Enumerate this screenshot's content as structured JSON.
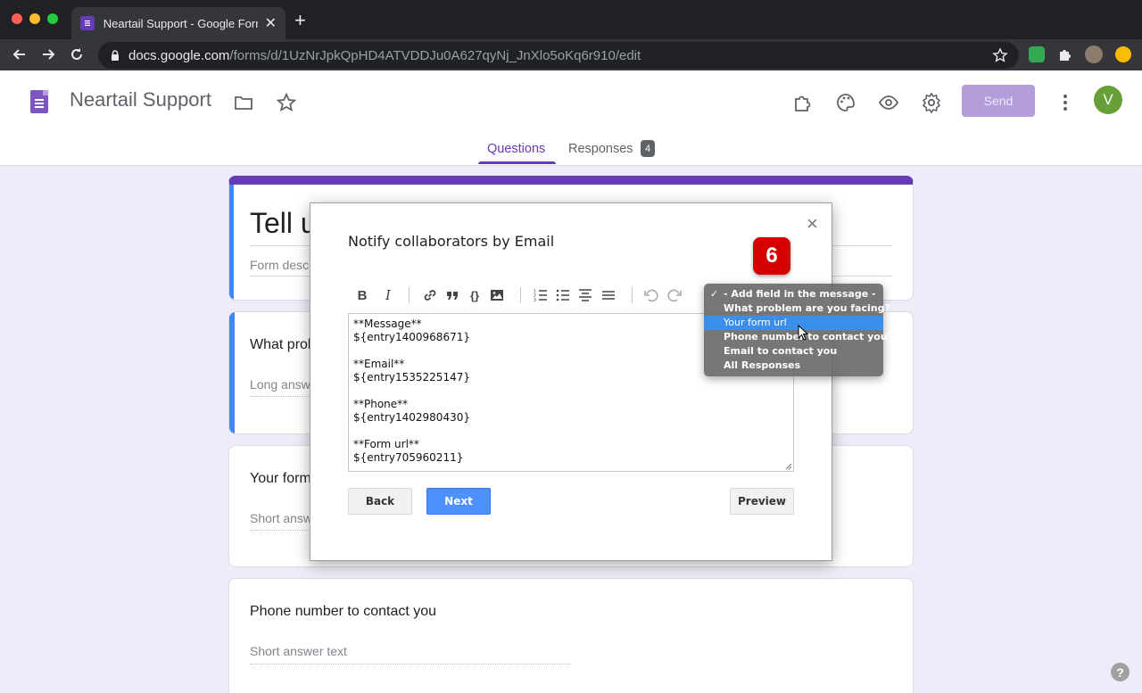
{
  "browser": {
    "tab_title": "Neartail Support - Google Form",
    "tab_close": "✕",
    "new_tab": "+",
    "url_host": "docs.google.com",
    "url_path": "/forms/d/1UzNrJpkQpHD4ATVDDJu0A627qyNj_JnXlo5oKq6r910/edit"
  },
  "header": {
    "doc_title": "Neartail Support",
    "send_label": "Send",
    "avatar_letter": "V"
  },
  "tabs": {
    "questions": "Questions",
    "responses": "Responses",
    "responses_count": "4"
  },
  "form": {
    "title_partial": "Tell u",
    "desc_partial": "Form desc",
    "q1_title_partial": "What prob",
    "q1_hint_partial": "Long answ",
    "q2_title_partial": "Your form",
    "q2_hint_partial": "Short answ",
    "q3_title": "Phone number to contact you",
    "q3_hint": "Short answer text"
  },
  "modal": {
    "close": "×",
    "title": "Notify collaborators by Email",
    "step_badge": "6",
    "editor_lines": {
      "l1": "**Message**",
      "l2": "${entry1400968671}",
      "l3": "**Email**",
      "l4": "${entry1535225147}",
      "l5": "**Phone**",
      "l6": "${entry1402980430}",
      "l7": "**Form url**",
      "l8": "${entry705960211}"
    },
    "back_label": "Back",
    "next_label": "Next",
    "preview_label": "Preview"
  },
  "dropdown": {
    "check": "✓",
    "items": [
      "- Add field in the message -",
      "What problem are you facing?",
      "Your form url",
      "Phone number to contact you",
      "Email to contact you",
      "All Responses"
    ]
  },
  "help": "?",
  "colors": {
    "accent": "#673ab7",
    "send_disabled": "#b39ddb",
    "next_button": "#4d90fe",
    "step_badge": "#d50000",
    "dropdown_selected": "#3b8eea"
  }
}
